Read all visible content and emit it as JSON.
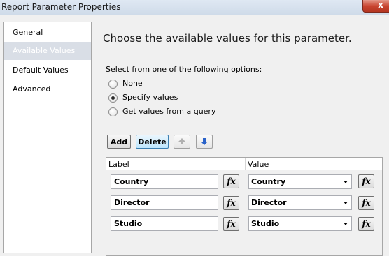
{
  "window": {
    "title": "Report Parameter Properties",
    "close_glyph": "x"
  },
  "sidebar": {
    "items": [
      {
        "label": "General",
        "selected": false
      },
      {
        "label": "Available Values",
        "selected": true
      },
      {
        "label": "Default Values",
        "selected": false
      },
      {
        "label": "Advanced",
        "selected": false
      }
    ]
  },
  "main": {
    "heading": "Choose the available values for this parameter.",
    "options_label": "Select from one of the following options:",
    "options": [
      {
        "label": "None",
        "checked": false
      },
      {
        "label": "Specify values",
        "checked": true
      },
      {
        "label": "Get values from a query",
        "checked": false
      }
    ]
  },
  "toolbar": {
    "add_label": "Add",
    "delete_label": "Delete",
    "move_up_icon": "arrow-up-icon",
    "move_down_icon": "arrow-down-icon"
  },
  "grid": {
    "columns": [
      "Label",
      "Value"
    ],
    "fx_glyph": "fx",
    "rows": [
      {
        "label": "Country",
        "value": "Country"
      },
      {
        "label": "Director",
        "value": "Director"
      },
      {
        "label": "Studio",
        "value": "Studio"
      }
    ]
  },
  "colors": {
    "selected_nav_bg": "#d9dee6",
    "focus_button_border": "#3c7fb1",
    "move_down_arrow": "#2a62c9"
  }
}
